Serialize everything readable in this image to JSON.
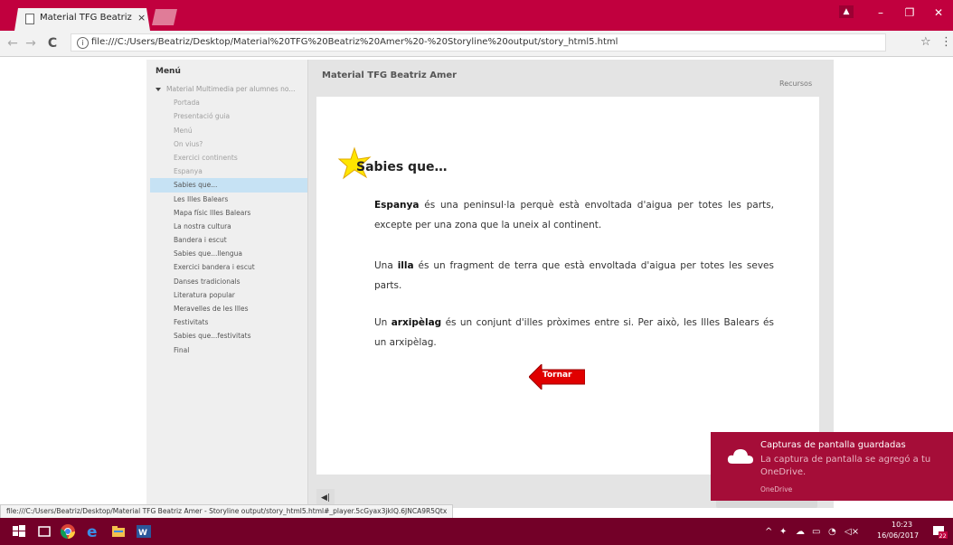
{
  "browser": {
    "tab_title": "Material TFG Beatriz Ame",
    "tab_close": "×",
    "url": "file:///C:/Users/Beatriz/Desktop/Material%20TFG%20Beatriz%20Amer%20-%20Storyline%20output/story_html5.html",
    "back": "←",
    "forward": "→",
    "reload": "C",
    "bookmark": "☆",
    "menu": "⋮",
    "win_min": "–",
    "win_max": "❐",
    "win_close": "✕",
    "user": "▲"
  },
  "player": {
    "course_title": "Material TFG Beatriz Amer",
    "resources": "Recursos",
    "menu_title": "Menú",
    "menu_items": [
      {
        "label": "Material Multimedia per alumnes no...",
        "state": "parent"
      },
      {
        "label": "Portada",
        "state": "visited"
      },
      {
        "label": "Presentació guia",
        "state": "visited"
      },
      {
        "label": "Menú",
        "state": "visited"
      },
      {
        "label": "On vius?",
        "state": "visited"
      },
      {
        "label": "Exercici continents",
        "state": "visited"
      },
      {
        "label": "Espanya",
        "state": "visited"
      },
      {
        "label": "Sabies que...",
        "state": "active"
      },
      {
        "label": "Les Illes Balears",
        "state": "normal"
      },
      {
        "label": "Mapa físic Illes Balears",
        "state": "normal"
      },
      {
        "label": "La nostra cultura",
        "state": "normal"
      },
      {
        "label": "Bandera i escut",
        "state": "normal"
      },
      {
        "label": "Sabies que...llengua",
        "state": "normal"
      },
      {
        "label": "Exercici bandera i escut",
        "state": "normal"
      },
      {
        "label": "Danses tradicionals",
        "state": "normal"
      },
      {
        "label": "Literatura popular",
        "state": "normal"
      },
      {
        "label": "Meravelles de les Illes",
        "state": "normal"
      },
      {
        "label": "Festivitats",
        "state": "normal"
      },
      {
        "label": "Sabies que...festivitats",
        "state": "normal"
      },
      {
        "label": "Final",
        "state": "normal"
      }
    ]
  },
  "slide": {
    "heading": "Sabies que…",
    "p1_bold": "Espanya",
    "p1_rest": " és una peninsul·la perquè està envoltada d'aigua per totes les parts, excepte per una zona que la uneix al continent.",
    "p2_start": "Una ",
    "p2_bold": "illa",
    "p2_rest": " és un fragment de terra que està envoltada d'aigua per totes les seves parts.",
    "p3_start": "Un ",
    "p3_bold": "arxipèlag",
    "p3_rest": " és un conjunt d'illes pròximes entre si. Per això, les Illes Balears és un arxipèlag.",
    "back_button": "Tornar"
  },
  "status_url": "file:///C:/Users/Beatriz/Desktop/Material TFG Beatriz Amer - Storyline output/story_html5.html#_player.5cGyax3jkIQ.6JNCA9R5Qtx",
  "notification": {
    "title": "Capturas de pantalla guardadas",
    "body": "La captura de pantalla se agregó a tu OneDrive.",
    "source": "OneDrive"
  },
  "taskbar": {
    "time": "10:23",
    "date": "16/06/2017",
    "notif_count": "22",
    "tray_chevron": "^"
  },
  "colors": {
    "chrome_accent": "#c1003e",
    "taskbar": "#730028",
    "toast": "#a50d38",
    "active_menu": "#c6e2f4",
    "tornar_arrow": "#e00000"
  }
}
